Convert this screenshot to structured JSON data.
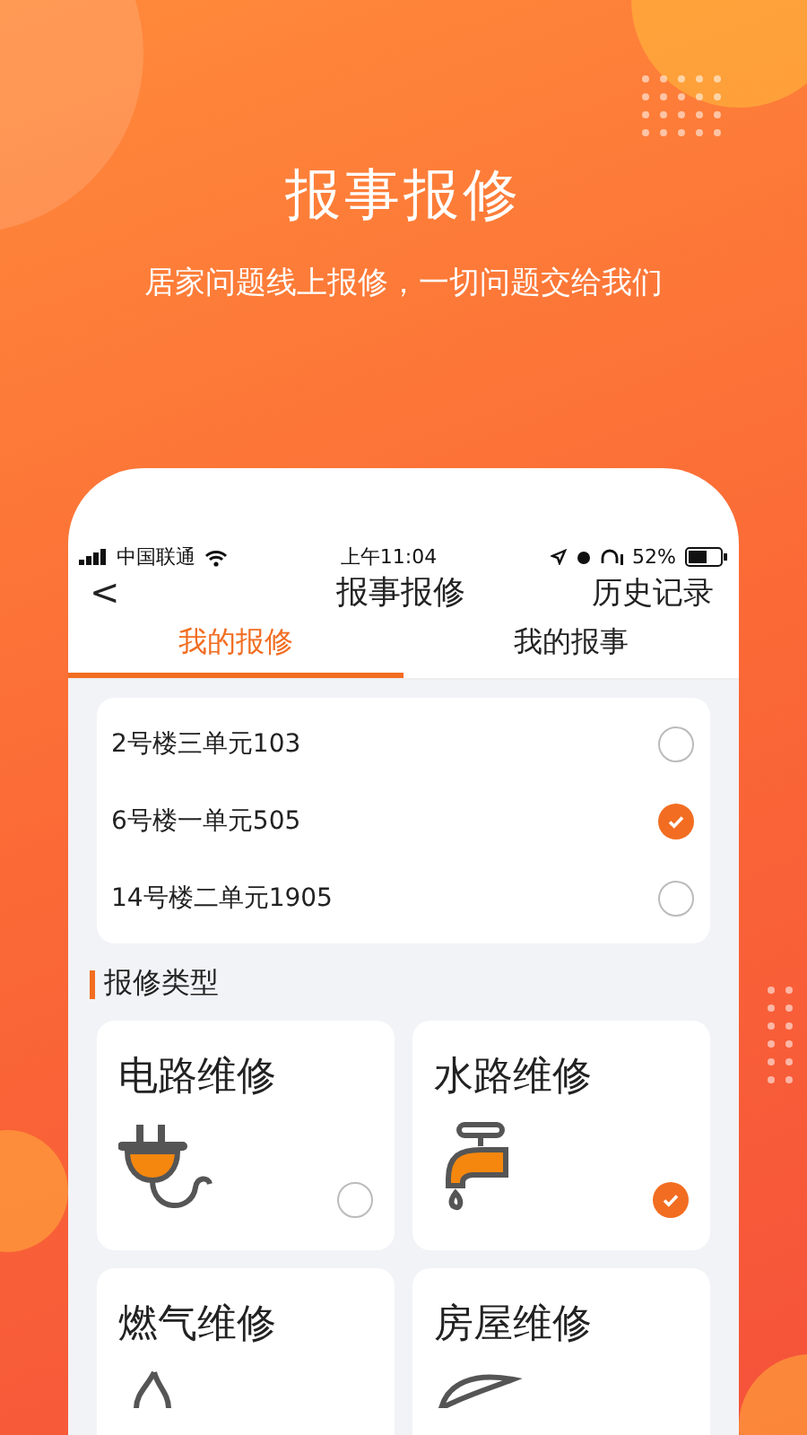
{
  "banner": {
    "title": "报事报修",
    "subtitle": "居家问题线上报修，一切问题交给我们"
  },
  "status_bar": {
    "carrier": "中国联通",
    "time": "上午11:04",
    "battery": "52%"
  },
  "nav": {
    "back": "<",
    "title": "报事报修",
    "action": "历史记录"
  },
  "tabs": [
    {
      "label": "我的报修",
      "selected": true
    },
    {
      "label": "我的报事",
      "selected": false
    }
  ],
  "addresses": [
    {
      "label": "2号楼三单元103",
      "selected": false
    },
    {
      "label": "6号楼一单元505",
      "selected": true
    },
    {
      "label": "14号楼二单元1905",
      "selected": false
    }
  ],
  "section_title": "报修类型",
  "categories": [
    {
      "kind": "electric",
      "label": "电路维修",
      "selected": false
    },
    {
      "kind": "water",
      "label": "水路维修",
      "selected": true
    },
    {
      "kind": "gas",
      "label": "燃气维修"
    },
    {
      "kind": "house",
      "label": "房屋维修"
    }
  ]
}
